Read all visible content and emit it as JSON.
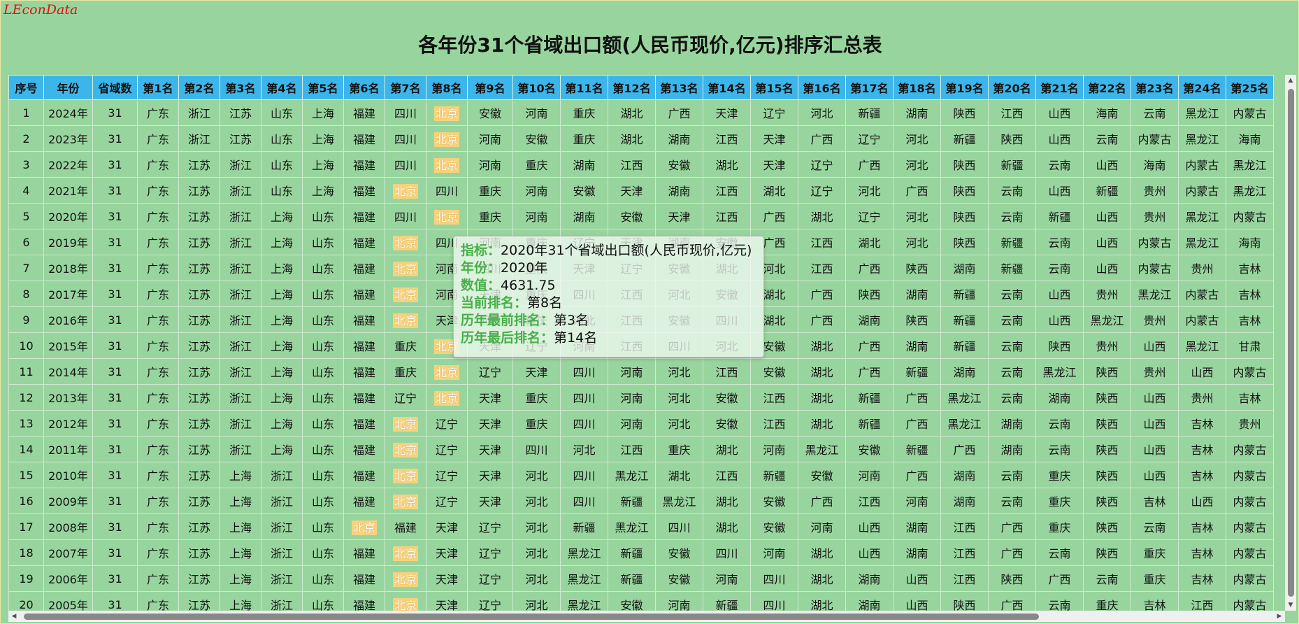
{
  "brand": "LEconData",
  "title": "各年份31个省域出口额(人民币现价,亿元)排序汇总表",
  "headers": [
    "序号",
    "年份",
    "省域数",
    "第1名",
    "第2名",
    "第3名",
    "第4名",
    "第5名",
    "第6名",
    "第7名",
    "第8名",
    "第9名",
    "第10名",
    "第11名",
    "第12名",
    "第13名",
    "第14名",
    "第15名",
    "第16名",
    "第17名",
    "第18名",
    "第19名",
    "第20名",
    "第21名",
    "第22名",
    "第23名",
    "第24名",
    "第25名"
  ],
  "highlight_value": "北京",
  "rows": [
    [
      "1",
      "2024年",
      "31",
      "广东",
      "浙江",
      "江苏",
      "山东",
      "上海",
      "福建",
      "四川",
      "北京",
      "安徽",
      "河南",
      "重庆",
      "湖北",
      "广西",
      "天津",
      "辽宁",
      "河北",
      "新疆",
      "湖南",
      "陕西",
      "江西",
      "山西",
      "海南",
      "云南",
      "黑龙江",
      "内蒙古"
    ],
    [
      "2",
      "2023年",
      "31",
      "广东",
      "浙江",
      "江苏",
      "山东",
      "上海",
      "福建",
      "四川",
      "北京",
      "河南",
      "安徽",
      "重庆",
      "湖北",
      "湖南",
      "江西",
      "天津",
      "广西",
      "辽宁",
      "河北",
      "新疆",
      "陕西",
      "山西",
      "云南",
      "内蒙古",
      "黑龙江",
      "海南"
    ],
    [
      "3",
      "2022年",
      "31",
      "广东",
      "江苏",
      "浙江",
      "山东",
      "上海",
      "福建",
      "四川",
      "北京",
      "河南",
      "重庆",
      "湖南",
      "江西",
      "安徽",
      "湖北",
      "天津",
      "辽宁",
      "广西",
      "河北",
      "陕西",
      "新疆",
      "云南",
      "山西",
      "海南",
      "内蒙古",
      "黑龙江"
    ],
    [
      "4",
      "2021年",
      "31",
      "广东",
      "江苏",
      "浙江",
      "山东",
      "上海",
      "福建",
      "北京",
      "四川",
      "重庆",
      "河南",
      "安徽",
      "天津",
      "湖南",
      "江西",
      "湖北",
      "辽宁",
      "河北",
      "广西",
      "陕西",
      "云南",
      "山西",
      "新疆",
      "贵州",
      "内蒙古",
      "黑龙江"
    ],
    [
      "5",
      "2020年",
      "31",
      "广东",
      "江苏",
      "浙江",
      "上海",
      "山东",
      "福建",
      "四川",
      "北京",
      "重庆",
      "河南",
      "湖南",
      "安徽",
      "天津",
      "江西",
      "广西",
      "湖北",
      "辽宁",
      "河北",
      "陕西",
      "云南",
      "新疆",
      "山西",
      "贵州",
      "黑龙江",
      "内蒙古"
    ],
    [
      "6",
      "2019年",
      "31",
      "广东",
      "江苏",
      "浙江",
      "上海",
      "山东",
      "福建",
      "北京",
      "四川",
      "河南",
      "重庆",
      "辽宁",
      "天津",
      "湖南",
      "安徽",
      "广西",
      "江西",
      "湖北",
      "河北",
      "陕西",
      "新疆",
      "云南",
      "山西",
      "内蒙古",
      "黑龙江",
      "海南"
    ],
    [
      "7",
      "2018年",
      "31",
      "广东",
      "江苏",
      "浙江",
      "上海",
      "山东",
      "福建",
      "北京",
      "河南",
      "四川",
      "重庆",
      "天津",
      "辽宁",
      "安徽",
      "湖北",
      "河北",
      "江西",
      "广西",
      "陕西",
      "湖南",
      "新疆",
      "云南",
      "山西",
      "内蒙古",
      "贵州",
      "吉林"
    ],
    [
      "8",
      "2017年",
      "31",
      "广东",
      "江苏",
      "浙江",
      "上海",
      "山东",
      "福建",
      "北京",
      "河南",
      "天津",
      "重庆",
      "四川",
      "江西",
      "河北",
      "安徽",
      "湖北",
      "广西",
      "陕西",
      "湖南",
      "新疆",
      "云南",
      "山西",
      "贵州",
      "黑龙江",
      "内蒙古",
      "吉林"
    ],
    [
      "9",
      "2016年",
      "31",
      "广东",
      "江苏",
      "浙江",
      "上海",
      "山东",
      "福建",
      "北京",
      "天津",
      "河南",
      "重庆",
      "河北",
      "江西",
      "安徽",
      "四川",
      "湖北",
      "广西",
      "湖南",
      "陕西",
      "新疆",
      "云南",
      "山西",
      "黑龙江",
      "贵州",
      "内蒙古",
      "吉林"
    ],
    [
      "10",
      "2015年",
      "31",
      "广东",
      "江苏",
      "浙江",
      "上海",
      "山东",
      "福建",
      "重庆",
      "北京",
      "天津",
      "辽宁",
      "河南",
      "江西",
      "四川",
      "河北",
      "安徽",
      "湖北",
      "广西",
      "湖南",
      "新疆",
      "云南",
      "陕西",
      "贵州",
      "山西",
      "黑龙江",
      "甘肃"
    ],
    [
      "11",
      "2014年",
      "31",
      "广东",
      "江苏",
      "浙江",
      "上海",
      "山东",
      "福建",
      "重庆",
      "北京",
      "辽宁",
      "天津",
      "四川",
      "河南",
      "河北",
      "江西",
      "安徽",
      "湖北",
      "广西",
      "新疆",
      "湖南",
      "云南",
      "黑龙江",
      "陕西",
      "贵州",
      "山西",
      "内蒙古"
    ],
    [
      "12",
      "2013年",
      "31",
      "广东",
      "江苏",
      "浙江",
      "上海",
      "山东",
      "福建",
      "辽宁",
      "北京",
      "天津",
      "重庆",
      "四川",
      "河南",
      "河北",
      "安徽",
      "江西",
      "湖北",
      "新疆",
      "广西",
      "黑龙江",
      "云南",
      "湖南",
      "陕西",
      "山西",
      "贵州",
      "吉林"
    ],
    [
      "13",
      "2012年",
      "31",
      "广东",
      "江苏",
      "浙江",
      "上海",
      "山东",
      "福建",
      "北京",
      "辽宁",
      "天津",
      "重庆",
      "四川",
      "河南",
      "河北",
      "安徽",
      "江西",
      "湖北",
      "新疆",
      "广西",
      "黑龙江",
      "湖南",
      "云南",
      "陕西",
      "山西",
      "吉林",
      "贵州"
    ],
    [
      "14",
      "2011年",
      "31",
      "广东",
      "江苏",
      "浙江",
      "上海",
      "山东",
      "福建",
      "北京",
      "辽宁",
      "天津",
      "四川",
      "河北",
      "江西",
      "重庆",
      "湖北",
      "河南",
      "黑龙江",
      "安徽",
      "新疆",
      "广西",
      "湖南",
      "云南",
      "陕西",
      "山西",
      "吉林",
      "内蒙古"
    ],
    [
      "15",
      "2010年",
      "31",
      "广东",
      "江苏",
      "上海",
      "浙江",
      "山东",
      "福建",
      "北京",
      "辽宁",
      "天津",
      "河北",
      "四川",
      "黑龙江",
      "湖北",
      "江西",
      "新疆",
      "安徽",
      "河南",
      "广西",
      "湖南",
      "云南",
      "重庆",
      "陕西",
      "山西",
      "吉林",
      "内蒙古"
    ],
    [
      "16",
      "2009年",
      "31",
      "广东",
      "江苏",
      "上海",
      "浙江",
      "山东",
      "福建",
      "北京",
      "辽宁",
      "天津",
      "河北",
      "四川",
      "新疆",
      "黑龙江",
      "湖北",
      "安徽",
      "广西",
      "江西",
      "河南",
      "湖南",
      "云南",
      "重庆",
      "陕西",
      "吉林",
      "山西",
      "内蒙古"
    ],
    [
      "17",
      "2008年",
      "31",
      "广东",
      "江苏",
      "上海",
      "浙江",
      "山东",
      "北京",
      "福建",
      "天津",
      "辽宁",
      "河北",
      "新疆",
      "黑龙江",
      "四川",
      "湖北",
      "安徽",
      "河南",
      "山西",
      "湖南",
      "江西",
      "广西",
      "重庆",
      "陕西",
      "云南",
      "吉林",
      "内蒙古"
    ],
    [
      "18",
      "2007年",
      "31",
      "广东",
      "江苏",
      "上海",
      "浙江",
      "山东",
      "福建",
      "北京",
      "天津",
      "辽宁",
      "河北",
      "黑龙江",
      "新疆",
      "安徽",
      "四川",
      "河南",
      "湖北",
      "山西",
      "湖南",
      "江西",
      "广西",
      "云南",
      "陕西",
      "重庆",
      "吉林",
      "内蒙古"
    ],
    [
      "19",
      "2006年",
      "31",
      "广东",
      "江苏",
      "上海",
      "浙江",
      "山东",
      "福建",
      "北京",
      "天津",
      "辽宁",
      "河北",
      "黑龙江",
      "新疆",
      "安徽",
      "河南",
      "四川",
      "湖北",
      "湖南",
      "山西",
      "江西",
      "陕西",
      "广西",
      "云南",
      "重庆",
      "吉林",
      "内蒙古"
    ],
    [
      "20",
      "2005年",
      "31",
      "广东",
      "江苏",
      "上海",
      "浙江",
      "山东",
      "福建",
      "北京",
      "天津",
      "辽宁",
      "河北",
      "黑龙江",
      "安徽",
      "河南",
      "新疆",
      "四川",
      "湖北",
      "湖南",
      "山西",
      "陕西",
      "广西",
      "云南",
      "重庆",
      "吉林",
      "江西",
      "内蒙古"
    ]
  ],
  "tooltip": {
    "k1": "指标：",
    "v1": "2020年31个省域出口额(人民币现价,亿元)",
    "k2": "年份：",
    "v2": "2020年",
    "k3": "数值：",
    "v3": "4631.75",
    "k4": "当前排名：",
    "v4": "第8名",
    "k5": "历年最前排名：",
    "v5": "第3名",
    "k6": "历年最后排名：",
    "v6": "第14名"
  }
}
